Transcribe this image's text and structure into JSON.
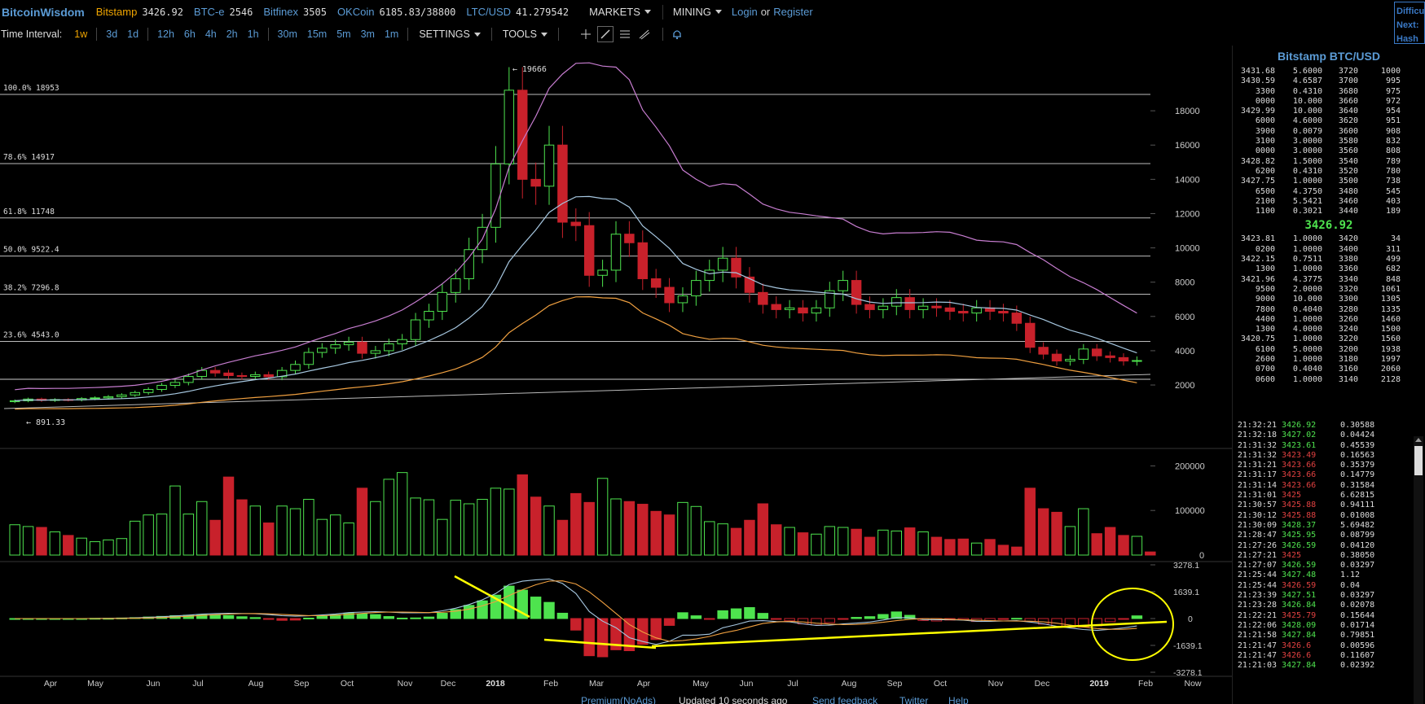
{
  "header": {
    "logo": "BitcoinWisdom",
    "markets": [
      {
        "name": "Bitstamp",
        "price": "3426.92",
        "color": "#f0a500"
      },
      {
        "name": "BTC-e",
        "price": "2546",
        "color": "#5b9bd5"
      },
      {
        "name": "Bitfinex",
        "price": "3505",
        "color": "#5b9bd5"
      },
      {
        "name": "OKCoin",
        "price": "6185.83/38800",
        "color": "#5b9bd5"
      },
      {
        "name": "LTC/USD",
        "price": "41.279542",
        "color": "#5b9bd5"
      }
    ],
    "markets_menu": "MARKETS",
    "mining_menu": "MINING",
    "login": "Login",
    "or": "or",
    "register": "Register",
    "difficulty_box": [
      "Difficu",
      "Next:",
      "Hash R"
    ]
  },
  "toolbar": {
    "time_interval_label": "Time Interval:",
    "intervals": [
      "1w",
      "3d",
      "1d",
      "12h",
      "6h",
      "4h",
      "2h",
      "1h",
      "30m",
      "15m",
      "5m",
      "3m",
      "1m"
    ],
    "active_interval": "1w",
    "settings": "SETTINGS",
    "tools": "TOOLS"
  },
  "chart_data": {
    "type": "candlestick",
    "market": "Bitstamp BTC/USD",
    "interval": "1w",
    "price_axis": {
      "ticks": [
        2000,
        4000,
        6000,
        8000,
        10000,
        12000,
        14000,
        16000,
        18000
      ],
      "range": [
        1100,
        20000
      ]
    },
    "volume_axis": {
      "ticks": [
        "0",
        "100000",
        "200000"
      ],
      "range": [
        0,
        230000
      ]
    },
    "macd_axis": {
      "ticks": [
        "3278.1",
        "1639.1",
        "0",
        "-1639.1",
        "-3278.1"
      ]
    },
    "x_labels": [
      "Apr",
      "May",
      "Jun",
      "Jul",
      "Aug",
      "Sep",
      "Oct",
      "Nov",
      "Dec",
      "2018",
      "Feb",
      "Mar",
      "Apr",
      "May",
      "Jun",
      "Jul",
      "Aug",
      "Sep",
      "Oct",
      "Nov",
      "Dec",
      "2019",
      "Feb",
      "Now"
    ],
    "fibonacci": [
      {
        "label": "100.0% 18953",
        "value": 18953
      },
      {
        "label": "78.6% 14917",
        "value": 14917
      },
      {
        "label": "61.8% 11748",
        "value": 11748
      },
      {
        "label": "50.0% 9522.4",
        "value": 9522.4
      },
      {
        "label": "38.2% 7296.8",
        "value": 7296.8
      },
      {
        "label": "23.6% 4543.0",
        "value": 4543.0
      }
    ],
    "high_marker": "← 19666",
    "low_marker": "← 891.33",
    "closes": [
      1080,
      1180,
      1100,
      1150,
      1130,
      1210,
      1250,
      1320,
      1420,
      1560,
      1740,
      1980,
      2150,
      2500,
      2850,
      2700,
      2550,
      2500,
      2600,
      2480,
      2850,
      3200,
      3900,
      4150,
      4350,
      4500,
      3850,
      4000,
      4400,
      4650,
      5800,
      6300,
      7400,
      8200,
      9900,
      11200,
      14900,
      19200,
      14000,
      13600,
      16000,
      11500,
      11300,
      8400,
      8700,
      10800,
      10300,
      8200,
      7700,
      6800,
      7200,
      8100,
      8700,
      9400,
      8300,
      7400,
      6700,
      6400,
      6500,
      6200,
      6500,
      7500,
      8100,
      6700,
      6400,
      6600,
      7100,
      6400,
      6600,
      6500,
      6300,
      6200,
      6500,
      6300,
      6200,
      5600,
      4200,
      3800,
      3400,
      3500,
      4100,
      3700,
      3600,
      3400,
      3426.92
    ],
    "volumes": [
      68000,
      64000,
      62000,
      52000,
      44000,
      38000,
      30000,
      34000,
      37000,
      76000,
      90000,
      92000,
      155000,
      92000,
      120000,
      78000,
      175000,
      124000,
      110000,
      72000,
      110000,
      104000,
      125000,
      80000,
      90000,
      72000,
      150000,
      120000,
      170000,
      185000,
      128000,
      124000,
      80000,
      123000,
      115000,
      125000,
      150000,
      148000,
      180000,
      130000,
      110000,
      78000,
      138000,
      118000,
      172000,
      126000,
      120000,
      114000,
      98000,
      90000,
      118000,
      109000,
      75000,
      70000,
      60000,
      78000,
      115000,
      68000,
      62000,
      50000,
      47000,
      64000,
      62000,
      58000,
      40000,
      56000,
      54000,
      61000,
      52000,
      40000,
      35000,
      36000,
      27000,
      35000,
      22000,
      18000,
      150000,
      104000,
      96000,
      64000,
      104000,
      48000,
      62000,
      44000,
      42000,
      7000
    ],
    "candlestick_count": 86,
    "histogram_trend": "positive Apr–Dec 2017, negative Jan 2018 onward"
  },
  "orderbook": {
    "title": "Bitstamp BTC/USD",
    "asks": [
      [
        "3431.68",
        "5.6000",
        "3720",
        "1000"
      ],
      [
        "3430.59",
        "4.6587",
        "3700",
        "995"
      ],
      [
        "3300",
        "0.4310",
        "3680",
        "975"
      ],
      [
        "0000",
        "10.000",
        "3660",
        "972"
      ],
      [
        "3429.99",
        "10.000",
        "3640",
        "954"
      ],
      [
        "6000",
        "4.6000",
        "3620",
        "951"
      ],
      [
        "3900",
        "0.0079",
        "3600",
        "908"
      ],
      [
        "3100",
        "3.0000",
        "3580",
        "832"
      ],
      [
        "0000",
        "3.0000",
        "3560",
        "808"
      ],
      [
        "3428.82",
        "1.5000",
        "3540",
        "789"
      ],
      [
        "6200",
        "0.4310",
        "3520",
        "780"
      ],
      [
        "3427.75",
        "1.0000",
        "3500",
        "738"
      ],
      [
        "6500",
        "4.3750",
        "3480",
        "545"
      ],
      [
        "2100",
        "5.5421",
        "3460",
        "403"
      ],
      [
        "1100",
        "0.3021",
        "3440",
        "189"
      ]
    ],
    "last_price": "3426.92",
    "bids": [
      [
        "3423.81",
        "1.0000",
        "3420",
        "34"
      ],
      [
        "0200",
        "1.0000",
        "3400",
        "311"
      ],
      [
        "3422.15",
        "0.7511",
        "3380",
        "499"
      ],
      [
        "1300",
        "1.0000",
        "3360",
        "682"
      ],
      [
        "3421.96",
        "4.3775",
        "3340",
        "848"
      ],
      [
        "9500",
        "2.0000",
        "3320",
        "1061"
      ],
      [
        "9000",
        "10.000",
        "3300",
        "1305"
      ],
      [
        "7800",
        "0.4040",
        "3280",
        "1335"
      ],
      [
        "4400",
        "1.0000",
        "3260",
        "1460"
      ],
      [
        "1300",
        "4.0000",
        "3240",
        "1500"
      ],
      [
        "3420.75",
        "1.0000",
        "3220",
        "1560"
      ],
      [
        "6100",
        "5.0000",
        "3200",
        "1938"
      ],
      [
        "2600",
        "1.0000",
        "3180",
        "1997"
      ],
      [
        "0700",
        "0.4040",
        "3160",
        "2060"
      ],
      [
        "0600",
        "1.0000",
        "3140",
        "2128"
      ]
    ]
  },
  "trades": [
    [
      "21:32:21",
      "3426.92",
      "0.30588",
      "up"
    ],
    [
      "21:32:18",
      "3427.02",
      "0.04424",
      "up"
    ],
    [
      "21:31:32",
      "3423.61",
      "0.45539",
      "up"
    ],
    [
      "21:31:32",
      "3423.49",
      "0.16563",
      "down"
    ],
    [
      "21:31:21",
      "3423.66",
      "0.35379",
      "down"
    ],
    [
      "21:31:17",
      "3423.66",
      "0.14779",
      "down"
    ],
    [
      "21:31:14",
      "3423.66",
      "0.31584",
      "down"
    ],
    [
      "21:31:01",
      "3425",
      "6.62815",
      "down"
    ],
    [
      "21:30:57",
      "3425.88",
      "0.94111",
      "down"
    ],
    [
      "21:30:12",
      "3425.88",
      "0.01008",
      "down"
    ],
    [
      "21:30:09",
      "3428.37",
      "5.69482",
      "up"
    ],
    [
      "21:28:47",
      "3425.95",
      "0.08799",
      "up"
    ],
    [
      "21:27:26",
      "3426.59",
      "0.04120",
      "up"
    ],
    [
      "21:27:21",
      "3425",
      "0.38050",
      "down"
    ],
    [
      "21:27:07",
      "3426.59",
      "0.03297",
      "up"
    ],
    [
      "21:25:44",
      "3427.48",
      "1.12",
      "up"
    ],
    [
      "21:25:44",
      "3426.59",
      "0.04",
      "down"
    ],
    [
      "21:23:39",
      "3427.51",
      "0.03297",
      "up"
    ],
    [
      "21:23:28",
      "3426.84",
      "0.02078",
      "up"
    ],
    [
      "21:22:21",
      "3425.79",
      "0.15644",
      "down"
    ],
    [
      "21:22:06",
      "3428.09",
      "0.01714",
      "up"
    ],
    [
      "21:21:58",
      "3427.84",
      "0.79851",
      "up"
    ],
    [
      "21:21:47",
      "3426.6",
      "0.00596",
      "down"
    ],
    [
      "21:21:47",
      "3426.6",
      "0.11607",
      "down"
    ],
    [
      "21:21:03",
      "3427.84",
      "0.02392",
      "up"
    ]
  ],
  "footer": {
    "premium": "Premium(NoAds)",
    "updated": "Updated 10 seconds ago",
    "feedback": "Send feedback",
    "twitter": "Twitter",
    "help": "Help"
  },
  "colors": {
    "up": "#4ee34e",
    "down": "#c8212b",
    "link": "#5b9bd5",
    "accent": "#f0a500",
    "annotation": "#ffff00"
  }
}
